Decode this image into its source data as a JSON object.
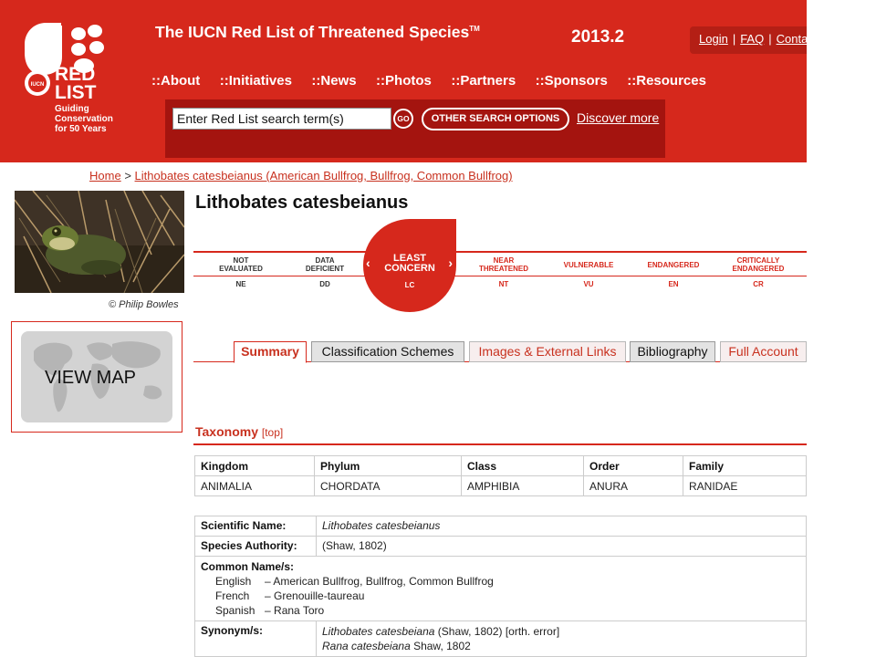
{
  "header": {
    "site_title": "The IUCN Red List of Threatened Species",
    "title_mark": "TM",
    "version": "2013.2",
    "logo": {
      "word": "RED",
      "word2": "LIST",
      "badge": "IUCN",
      "tagline_1": "Guiding",
      "tagline_2": "Conservation",
      "tagline_3": "for 50 Years"
    },
    "top_links": [
      {
        "label": "Login",
        "sep": "|"
      },
      {
        "label": "FAQ",
        "sep": "|"
      },
      {
        "label": "Conta"
      }
    ],
    "nav": [
      "::About",
      "::Initiatives",
      "::News",
      "::Photos",
      "::Partners",
      "::Sponsors",
      "::Resources"
    ],
    "search": {
      "placeholder": "Enter Red List search term(s)",
      "go_label": "GO",
      "other_options_label": "OTHER SEARCH OPTIONS",
      "discover_label": "Discover more"
    }
  },
  "breadcrumb": {
    "home": "Home",
    "separator": ">",
    "current": "Lithobates catesbeianus (American Bullfrog, Bullfrog, Common Bullfrog)"
  },
  "photo": {
    "credit": "© Philip Bowles"
  },
  "map": {
    "label": "VIEW MAP"
  },
  "species": {
    "name": "Lithobates catesbeianus",
    "current_status_line1": "LEAST",
    "current_status_line2": "CONCERN",
    "current_status_code": "LC",
    "prev_icon": "‹",
    "next_icon": "›",
    "statuses": [
      {
        "line1": "NOT",
        "line2": "EVALUATED",
        "code": "NE"
      },
      {
        "line1": "DATA",
        "line2": "DEFICIENT",
        "code": "DD"
      },
      {
        "line1": "NEAR",
        "line2": "THREATENED",
        "code": "NT"
      },
      {
        "line1": "VULNERABLE",
        "line2": "",
        "code": "VU"
      },
      {
        "line1": "ENDANGERED",
        "line2": "",
        "code": "EN"
      },
      {
        "line1": "CRITICALLY",
        "line2": "ENDANGERED",
        "code": "CR"
      }
    ]
  },
  "tabs": [
    {
      "label": "Summary",
      "active": true
    },
    {
      "label": "Classification Schemes"
    },
    {
      "label": "Images & External Links"
    },
    {
      "label": "Bibliography"
    },
    {
      "label": "Full Account"
    }
  ],
  "taxonomy": {
    "heading": "Taxonomy",
    "top_link": "[top]",
    "columns": [
      "Kingdom",
      "Phylum",
      "Class",
      "Order",
      "Family"
    ],
    "values": [
      "ANIMALIA",
      "CHORDATA",
      "AMPHIBIA",
      "ANURA",
      "RANIDAE"
    ]
  },
  "details": {
    "scientific_name_label": "Scientific Name:",
    "scientific_name": "Lithobates catesbeianus",
    "authority_label": "Species Authority:",
    "authority": "(Shaw, 1802)",
    "common_names_label": "Common Name/s:",
    "common_names": [
      {
        "lang": "English",
        "dash": "–",
        "names": "American Bullfrog, Bullfrog, Common Bullfrog"
      },
      {
        "lang": "French",
        "dash": "–",
        "names": "Grenouille-taureau"
      },
      {
        "lang": "Spanish",
        "dash": "–",
        "names": "Rana Toro"
      }
    ],
    "synonyms_label": "Synonym/s:",
    "synonyms": [
      {
        "name": "Lithobates catesbeiana",
        "rest": " (Shaw, 1802) [orth. error]"
      },
      {
        "name": "Rana catesbeiana",
        "rest": " Shaw, 1802"
      }
    ]
  },
  "colors": {
    "brand_red": "#d6281c",
    "dark_red": "#a4140f",
    "link_red": "#c8311f"
  }
}
